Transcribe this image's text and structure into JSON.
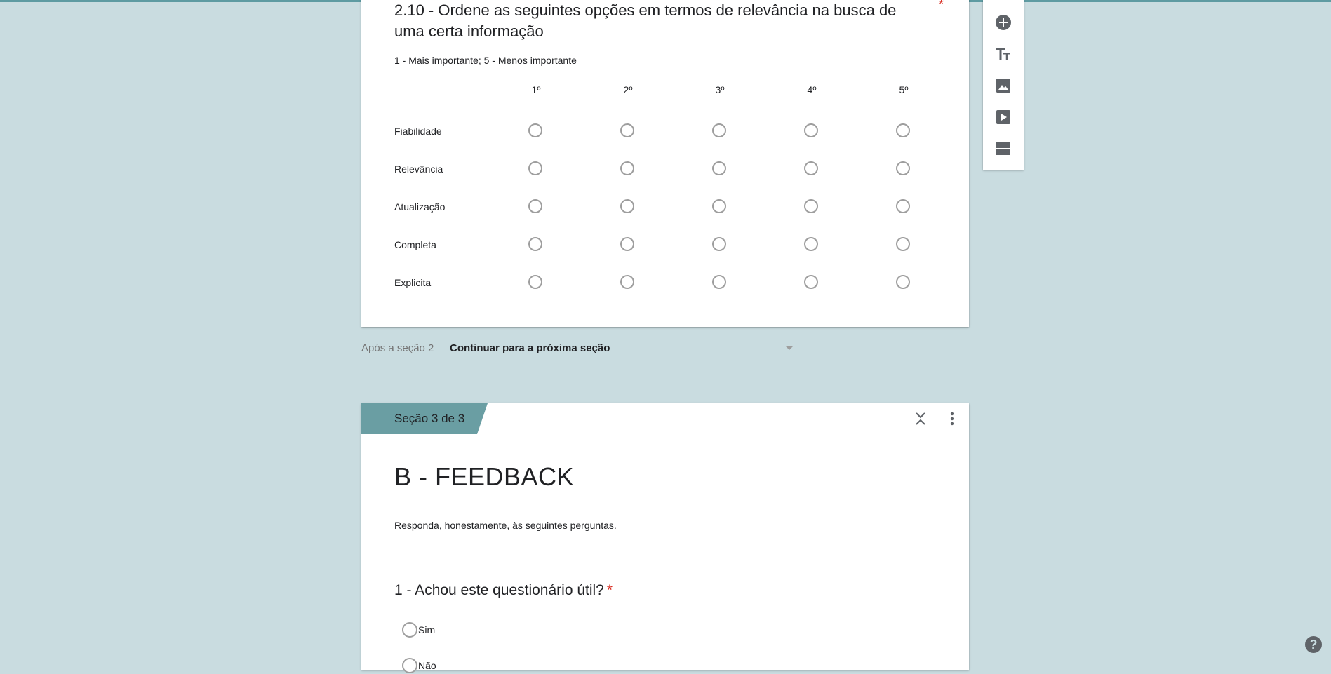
{
  "question_card": {
    "title": "2.10 - Ordene as seguintes opções em termos de relevância na busca de uma certa informação",
    "required_marker": "*",
    "description": "1 - Mais importante; 5 - Menos importante",
    "columns": [
      "1º",
      "2º",
      "3º",
      "4º",
      "5º"
    ],
    "rows": [
      "Fiabilidade",
      "Relevância",
      "Atualização",
      "Completa",
      "Explicita"
    ]
  },
  "toolbar": {
    "icons": [
      "add-question-icon",
      "add-title-icon",
      "add-image-icon",
      "add-video-icon",
      "add-section-icon"
    ]
  },
  "after_section": {
    "label": "Após a seção 2",
    "value": "Continuar para a próxima seção"
  },
  "section_card": {
    "tab_label": "Seção 3 de 3",
    "title": "B - FEEDBACK",
    "description": "Responda, honestamente, às seguintes perguntas.",
    "question": {
      "title": "1 - Achou este questionário útil?",
      "required_marker": "*",
      "options": [
        "Sim",
        "Não"
      ]
    }
  },
  "help": {
    "label": "?"
  },
  "colors": {
    "background": "#c9dce0",
    "accent": "#5e9ba2",
    "tab": "#6a9ea3",
    "required": "#d93025"
  }
}
